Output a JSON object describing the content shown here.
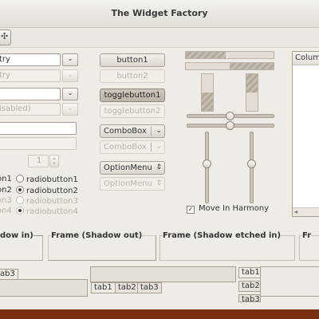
{
  "window": {
    "title": "The Widget Factory"
  },
  "col1": {
    "entry1": "try",
    "entry2": "try",
    "combo_disabled_label": "isabled)",
    "spin_value": "1",
    "radios": [
      {
        "label": "on1"
      },
      {
        "label": "on2"
      },
      {
        "label": "on3"
      },
      {
        "label": "on4"
      }
    ]
  },
  "col2": {
    "radios": [
      {
        "label": "radiobutton1"
      },
      {
        "label": "radiobutton2"
      },
      {
        "label": "radiobutton3"
      },
      {
        "label": "radiobutton4"
      }
    ]
  },
  "buttons": {
    "button1": "button1",
    "button2": "button2",
    "toggle1": "togglebutton1",
    "toggle2": "togglebutton2",
    "combobox1": "ComboBox",
    "combobox2": "ComboBox",
    "optionmenu1": "OptionMenu",
    "optionmenu2": "OptionMenu"
  },
  "progress": {
    "h1": 0.45,
    "h2": 0.5,
    "v1": 0.5,
    "v2": 0.5
  },
  "sliders": {
    "h1": 0.5,
    "h2": 0.5,
    "v1": 0.45,
    "v2": 0.45
  },
  "checkbox": {
    "label": "Move In Harmony",
    "checked": true
  },
  "tree": {
    "column": "Colum"
  },
  "frames": {
    "f1": "dow in)",
    "f2": "Frame (Shadow out)",
    "f3": "Frame (Shadow etched in)",
    "f4": "Fr"
  },
  "tabs_left": {
    "tab3": "ab3"
  },
  "tabs_mid": [
    "tab1",
    "tab2",
    "tab3"
  ],
  "tabs_right": [
    "tab1",
    "tab2",
    "tab3"
  ]
}
